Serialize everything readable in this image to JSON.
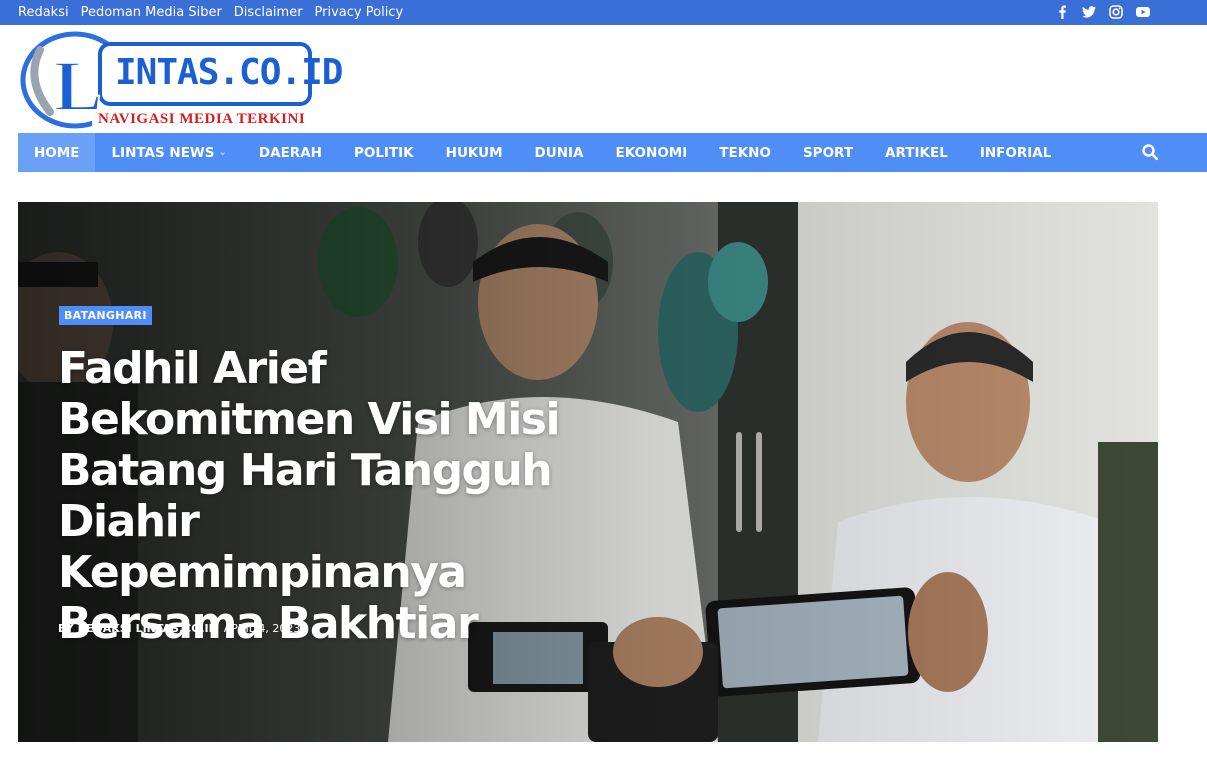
{
  "topbar": {
    "links": [
      "Redaksi",
      "Pedoman Media Siber",
      "Disclaimer",
      "Privacy Policy"
    ],
    "social_icons": [
      "facebook-icon",
      "twitter-icon",
      "instagram-icon",
      "youtube-icon"
    ],
    "bg_color": "#3a6fd8"
  },
  "logo": {
    "letter": "L",
    "name": "INTAS.CO.ID",
    "tagline": "NAVIGASI MEDIA TERKINI"
  },
  "nav": {
    "items": [
      {
        "label": "HOME",
        "active": true
      },
      {
        "label": "LINTAS NEWS",
        "dropdown": true
      },
      {
        "label": "DAERAH"
      },
      {
        "label": "POLITIK"
      },
      {
        "label": "HUKUM"
      },
      {
        "label": "DUNIA"
      },
      {
        "label": "EKONOMI"
      },
      {
        "label": "TEKNO"
      },
      {
        "label": "SPORT"
      },
      {
        "label": "ARTIKEL"
      },
      {
        "label": "INFORIAL"
      }
    ],
    "search_icon": "search-icon",
    "bg_color": "#4f8ef7"
  },
  "hero": {
    "category": "BATANGHARI",
    "title": "Fadhil Arief Bekomitmen Visi Misi Batang Hari Tangguh Diahir Kepemimpinanya Bersama Bakhtiar",
    "author": "BY REDAKSI LINTAS.CO.ID",
    "date": "APRIL 4, 2023"
  }
}
